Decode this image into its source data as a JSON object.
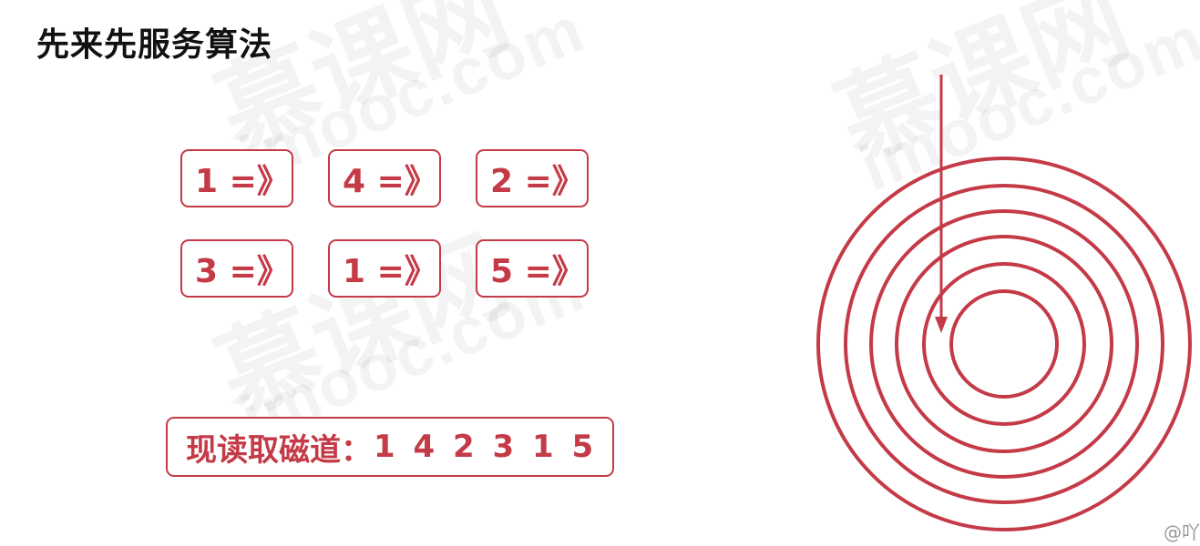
{
  "title": "先来先服务算法",
  "requests": [
    {
      "label": "1 =》"
    },
    {
      "label": "4 =》"
    },
    {
      "label": "2 =》"
    },
    {
      "label": "3 =》"
    },
    {
      "label": "1 =》"
    },
    {
      "label": "5 =》"
    }
  ],
  "result": {
    "label": "现读取磁道：",
    "sequence": "1 4 2 3 1 5"
  },
  "watermark": {
    "brand": "慕课网",
    "domain": "imooc.com"
  },
  "credit": "@吖",
  "colors": {
    "accent": "#c43a47",
    "title": "#111111"
  },
  "disk": {
    "track_count": 6
  }
}
